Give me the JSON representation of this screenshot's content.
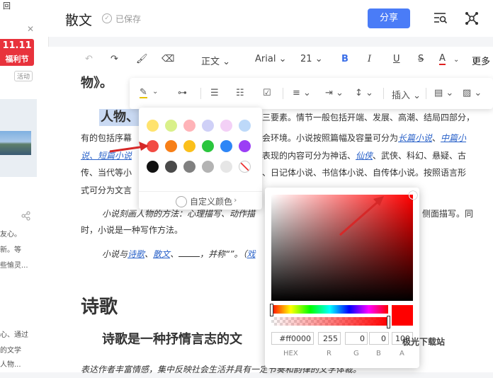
{
  "header": {
    "title": "散文",
    "saved": "已保存",
    "share": "分享"
  },
  "sidebar": {
    "top_glyph": "回",
    "promo_l1": "11.11",
    "promo_l2": "福利节",
    "badge": "活动",
    "lines": [
      "友心。",
      "新。等",
      "些愉灵...",
      "心、通过",
      "的文学",
      "人物..."
    ]
  },
  "toolbar": {
    "style": "正文",
    "font": "Arial",
    "size": "21",
    "bold": "B",
    "italic": "I",
    "underline": "U",
    "strike": "S",
    "color": "A",
    "more": "更多"
  },
  "toolbar2": {
    "insert": "插入"
  },
  "doc": {
    "l0": "物》。",
    "l1_head": "人物、",
    "l1_tail": "三要素。情节一般包括开端、发展、高潮、结局四部分，",
    "l2a": "有的包括序幕",
    "l2b": "会环境。小说按照篇幅及容量可分为",
    "l2link1": "长篇小说",
    "l2link2": "中篇小",
    "l3a": "说、短篇小说",
    "l3b": "表现的内容可分为神话、",
    "l3link": "仙侠",
    "l3c": "、武侠、科幻、悬疑、古",
    "l4a": "传、当代等小",
    "l4b": "、日记体小说、书信体小说、自传体小说。按照语言形",
    "l5": "式可分为文言",
    "l6": "小说刻画人物的方法：心理描写、动作描",
    "l6b": "侧面描写。同",
    "l7": "时，小说是一种写作方法。",
    "l8a": "小说与",
    "l8link1": "诗歌",
    "l8link2": "散文",
    "l8b": "，并称“”。（",
    "l8link3": "戏",
    "h_poetry": "诗歌",
    "sub_poetry": "诗歌是一种抒情言志的文",
    "l9": "表达作者丰富情感，集中反映社会生活并具有一定节奏和韵律的文学体裁。"
  },
  "palette": {
    "custom": "自定义颜色",
    "rows": [
      [
        "#ffe36e",
        "#d9f08a",
        "#ffb3b8",
        "#cfd0f7",
        "#f3d0f6",
        "#bdd9f9"
      ],
      [
        "#f24b43",
        "#f77f17",
        "#fbc01b",
        "#2bc63e",
        "#2e86f6",
        "#9b3ef5"
      ],
      [
        "#111111",
        "#4a4a4a",
        "#808080",
        "#b3b3b3",
        "#e6e6e6",
        "none"
      ]
    ]
  },
  "picker": {
    "hex": "#ff0000",
    "r": "255",
    "g": "0",
    "b": "0",
    "a": "100",
    "labels": [
      "HEX",
      "R",
      "G",
      "B",
      "A"
    ]
  },
  "watermark": "极光下载站"
}
